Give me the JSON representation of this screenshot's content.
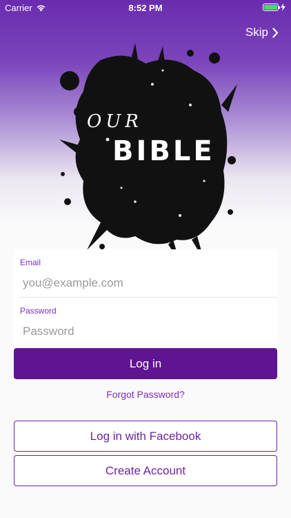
{
  "status_bar": {
    "carrier": "Carrier",
    "time": "8:52 PM",
    "battery_color": "#4cd964"
  },
  "header": {
    "skip_label": "Skip",
    "skip_icon": "chevron-right-icon"
  },
  "logo": {
    "word_top": "OUR",
    "word_bottom": "BIBLE"
  },
  "form": {
    "email_label": "Email",
    "email_placeholder": "you@example.com",
    "email_value": "",
    "password_label": "Password",
    "password_placeholder": "Password",
    "password_value": ""
  },
  "actions": {
    "login_label": "Log in",
    "forgot_label": "Forgot Password?",
    "facebook_label": "Log in with Facebook",
    "create_label": "Create Account"
  },
  "colors": {
    "accent": "#5f1591",
    "link": "#7a2cc0",
    "header_gradient_top": "#6a2cae"
  }
}
